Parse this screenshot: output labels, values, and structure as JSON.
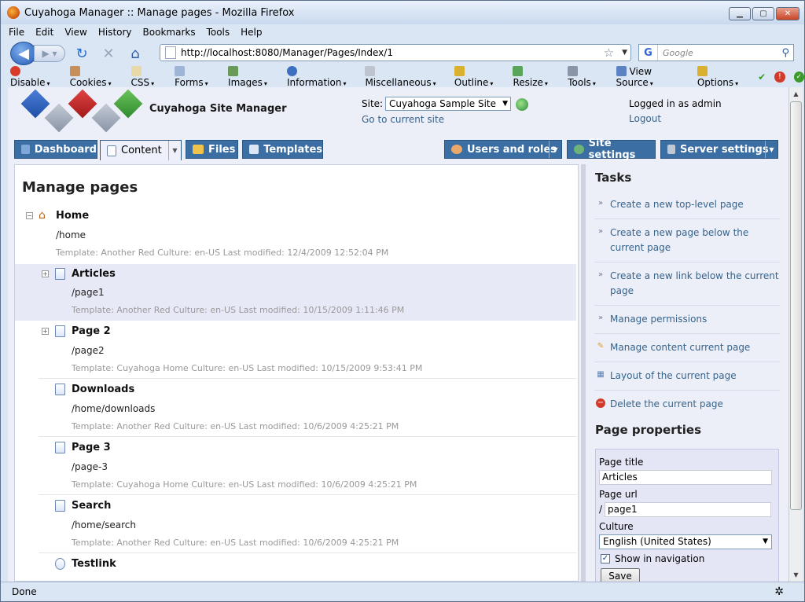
{
  "browser": {
    "window_title": "Cuyahoga Manager :: Manage pages - Mozilla Firefox",
    "menu": [
      "File",
      "Edit",
      "View",
      "History",
      "Bookmarks",
      "Tools",
      "Help"
    ],
    "url": "http://localhost:8080/Manager/Pages/Index/1",
    "search_placeholder": "Google",
    "search_engine_letter": "G",
    "status": "Done",
    "webdev_toolbar": [
      "Disable",
      "Cookies",
      "CSS",
      "Forms",
      "Images",
      "Information",
      "Miscellaneous",
      "Outline",
      "Resize",
      "Tools",
      "View Source",
      "Options"
    ]
  },
  "header": {
    "site_title": "Cuyahoga Site Manager",
    "site_label": "Site:",
    "site_selected": "Cuyahoga Sample Site",
    "goto_site": "Go to current site",
    "logged_in": "Logged in as admin",
    "logout": "Logout"
  },
  "tabs": {
    "dashboard": "Dashboard",
    "content": "Content",
    "files": "Files",
    "templates": "Templates",
    "users": "Users and roles",
    "site_settings": "Site settings",
    "server_settings": "Server settings"
  },
  "main": {
    "title": "Manage pages",
    "pages": [
      {
        "name": "Home",
        "path": "/home",
        "meta": "Template: Another Red   Culture: en-US   Last modified: 12/4/2009 12:52:04 PM"
      },
      {
        "name": "Articles",
        "path": "/page1",
        "meta": "Template: Another Red   Culture: en-US   Last modified: 10/15/2009 1:11:46 PM"
      },
      {
        "name": "Page 2",
        "path": "/page2",
        "meta": "Template: Cuyahoga Home   Culture: en-US   Last modified: 10/15/2009 9:53:41 PM"
      },
      {
        "name": "Downloads",
        "path": "/home/downloads",
        "meta": "Template: Another Red   Culture: en-US   Last modified: 10/6/2009 4:25:21 PM"
      },
      {
        "name": "Page 3",
        "path": "/page-3",
        "meta": "Template: Cuyahoga Home   Culture: en-US   Last modified: 10/6/2009 4:25:21 PM"
      },
      {
        "name": "Search",
        "path": "/home/search",
        "meta": "Template: Another Red   Culture: en-US   Last modified: 10/6/2009 4:25:21 PM"
      },
      {
        "name": "Testlink",
        "path": "",
        "meta": ""
      }
    ]
  },
  "tasks": {
    "title": "Tasks",
    "items": [
      "Create a new top-level page",
      "Create a new page below the current page",
      "Create a new link below the current page",
      "Manage permissions",
      "Manage content current page",
      "Layout of the current page",
      "Delete the current page"
    ]
  },
  "properties": {
    "title": "Page properties",
    "page_title_label": "Page title",
    "page_title_value": "Articles",
    "page_url_label": "Page url",
    "page_url_prefix": "/",
    "page_url_value": "page1",
    "culture_label": "Culture",
    "culture_value": "English (United States)",
    "show_nav_label": "Show in navigation",
    "save_label": "Save"
  }
}
